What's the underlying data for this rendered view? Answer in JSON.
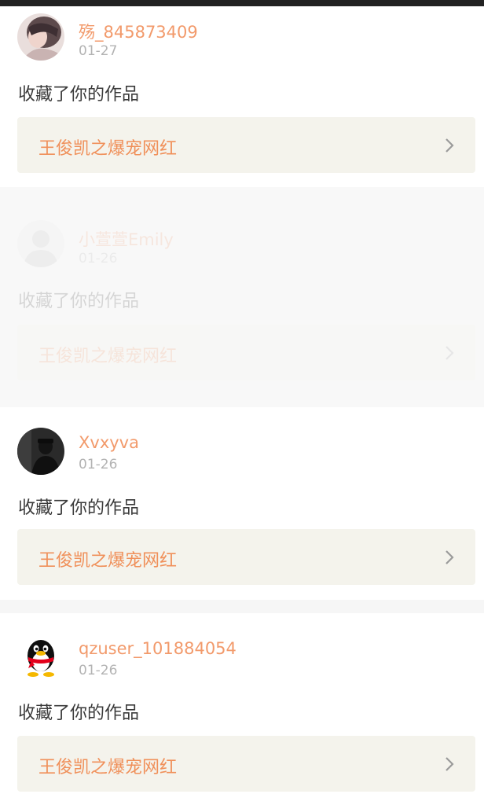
{
  "colors": {
    "accent": "#f29a6b",
    "work_title": "#f0905a",
    "date": "#b3b3b3",
    "text": "#3a3a3a",
    "link_bg": "#f4f3ec",
    "gap_bg": "#f6f6f6"
  },
  "notifications": [
    {
      "username": "殇_845873409",
      "date": "01-27",
      "action": "收藏了你的作品",
      "work_title": "王俊凯之爆宠网红",
      "avatar_icon": "girl-photo-avatar"
    },
    {
      "username": "小萱萱Emily",
      "date": "01-26",
      "action": "收藏了你的作品",
      "work_title": "王俊凯之爆宠网红",
      "avatar_icon": "default-silhouette-avatar"
    },
    {
      "username": "Xvxyva",
      "date": "01-26",
      "action": "收藏了你的作品",
      "work_title": "王俊凯之爆宠网红",
      "avatar_icon": "dark-photo-avatar"
    },
    {
      "username": "qzuser_101884054",
      "date": "01-26",
      "action": "收藏了你的作品",
      "work_title": "王俊凯之爆宠网红",
      "avatar_icon": "qq-penguin-avatar"
    }
  ]
}
